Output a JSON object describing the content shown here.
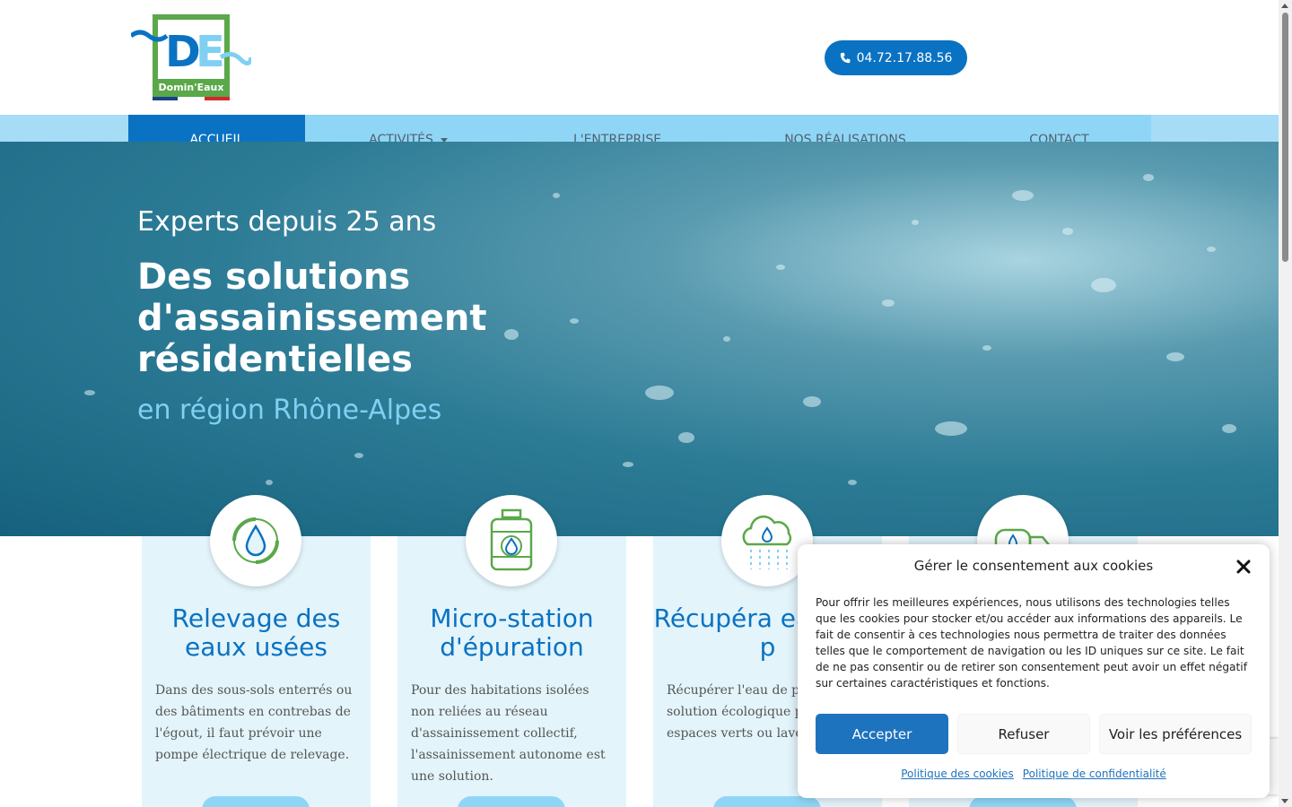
{
  "brand": {
    "logo_text": "Domin'Eaux",
    "logo_letters": "DE"
  },
  "header": {
    "phone": "04.72.17.88.56"
  },
  "nav": {
    "items": [
      {
        "label": "ACCUEIL",
        "active": true
      },
      {
        "label": "ACTIVITÉS",
        "has_dropdown": true
      },
      {
        "label": "L'ENTREPRISE"
      },
      {
        "label": "NOS RÉALISATIONS"
      },
      {
        "label": "CONTACT"
      }
    ]
  },
  "hero": {
    "subtitle": "Experts depuis 25 ans",
    "title": "Des solutions d'assainissement résidentielles",
    "region": "en région Rhône-Alpes"
  },
  "cards": [
    {
      "icon": "water-recycle-icon",
      "title": "Relevage des eaux usées",
      "text": "Dans des sous-sols enterrés ou des bâtiments en contrebas de l'égout, il faut prévoir une pompe électrique de relevage."
    },
    {
      "icon": "tank-icon",
      "title": "Micro-station d'épuration",
      "text": "Pour des habitations isolées non reliées au réseau d'assainissement collectif, l'assainissement autonome est une solution."
    },
    {
      "icon": "rain-cloud-icon",
      "title": "Récupéra eaux de p",
      "text": "Récupérer l'eau de pluie solution écologique pou espaces verts ou laver le"
    },
    {
      "icon": "tanker-truck-icon",
      "title": "",
      "text": ""
    }
  ],
  "cookie": {
    "title": "Gérer le consentement aux cookies",
    "text": "Pour offrir les meilleures expériences, nous utilisons des technologies telles que les cookies pour stocker et/ou accéder aux informations des appareils. Le fait de consentir à ces technologies nous permettra de traiter des données telles que le comportement de navigation ou les ID uniques sur ce site. Le fait de ne pas consentir ou de retirer son consentement peut avoir un effet négatif sur certaines caractéristiques et fonctions.",
    "accept": "Accepter",
    "refuse": "Refuser",
    "preferences": "Voir les préférences",
    "link_cookies": "Politique des cookies",
    "link_privacy": "Politique de confidentialité"
  },
  "colors": {
    "primary": "#0a72c2",
    "nav_bg": "#8fd6f6",
    "card_bg": "#e3f4fb",
    "accent_green": "#5aa84a"
  }
}
